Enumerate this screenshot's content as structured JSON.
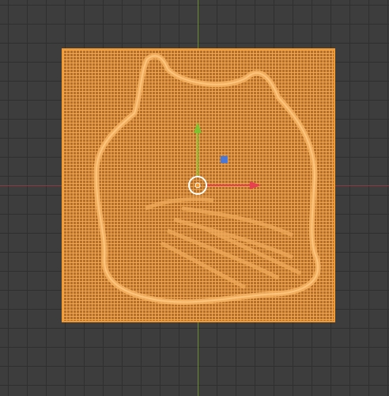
{
  "viewport": {
    "mode": "3d-viewport-top-orthographic",
    "background_color": "#3d3d3d",
    "grid_color": "#2f2f2f",
    "x_axis_color": "#8b3a44",
    "y_axis_color": "#6a8f2a"
  },
  "mesh": {
    "object": "plane-mesh",
    "selected": true,
    "outline_color": "#f29a30",
    "wire_color": "#f0a64d",
    "fill_color": "#b56f2c",
    "displacement_pattern": "cat-silhouette"
  },
  "gizmo": {
    "type": "translate",
    "x_handle_color": "#e8404f",
    "y_handle_color": "#7ec232",
    "z_plane_handle_color": "#4a78d6",
    "center_ring_color": "#ffffff"
  }
}
